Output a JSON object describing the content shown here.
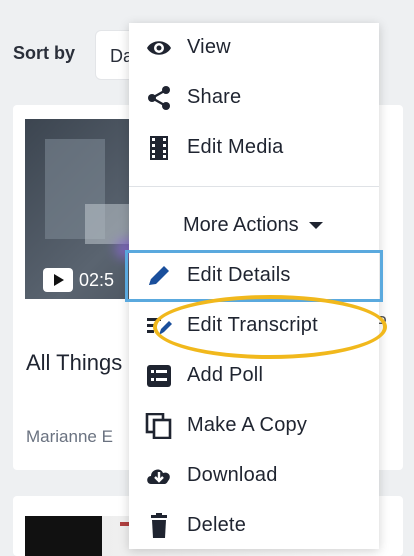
{
  "sort": {
    "label": "Sort by",
    "value": "Da"
  },
  "card": {
    "duration": "02:5",
    "title": "All Things",
    "author": "Marianne E",
    "trailing": "P"
  },
  "menu": {
    "items": [
      {
        "label": "View",
        "icon": "eye-icon"
      },
      {
        "label": "Share",
        "icon": "share-icon"
      },
      {
        "label": "Edit Media",
        "icon": "film-icon"
      }
    ],
    "more_actions": "More Actions",
    "actions": [
      {
        "label": "Edit Details",
        "icon": "pencil-icon"
      },
      {
        "label": "Edit Transcript",
        "icon": "transcript-icon"
      },
      {
        "label": "Add Poll",
        "icon": "poll-icon"
      },
      {
        "label": "Make A Copy",
        "icon": "copy-icon"
      },
      {
        "label": "Download",
        "icon": "cloud-download-icon"
      },
      {
        "label": "Delete",
        "icon": "trash-icon"
      }
    ]
  },
  "colors": {
    "highlight_box": "#5aa9de",
    "highlight_oval": "#f1b81c",
    "accent": "#1a73e8"
  }
}
